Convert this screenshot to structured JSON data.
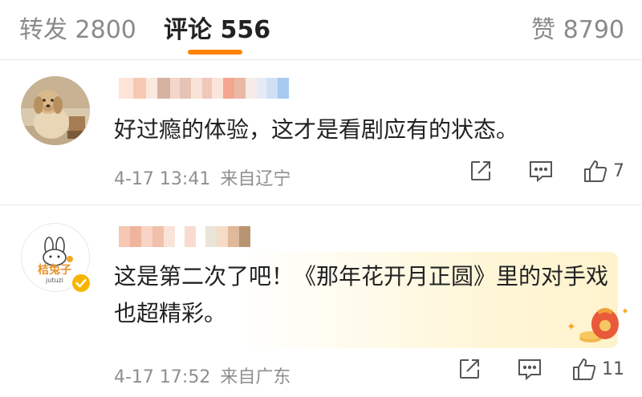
{
  "tabs": {
    "reposts": "转发 2800",
    "comments": "评论 556",
    "likes": "赞 8790"
  },
  "comments": [
    {
      "text": "好过瘾的体验，这才是看剧应有的状态。",
      "time": "4-17 13:41",
      "location": "来自辽宁",
      "likes": "7"
    },
    {
      "text": "这是第二次了吧！《那年花开月正圆》里的对手戏也超精彩。",
      "time": "4-17 17:52",
      "location": "来自广东",
      "likes": "11",
      "avatar_text": "桔兔子",
      "avatar_subtext": "jutuzi"
    }
  ],
  "colors": {
    "accent": "#ff8200",
    "verified": "#f7b500"
  }
}
